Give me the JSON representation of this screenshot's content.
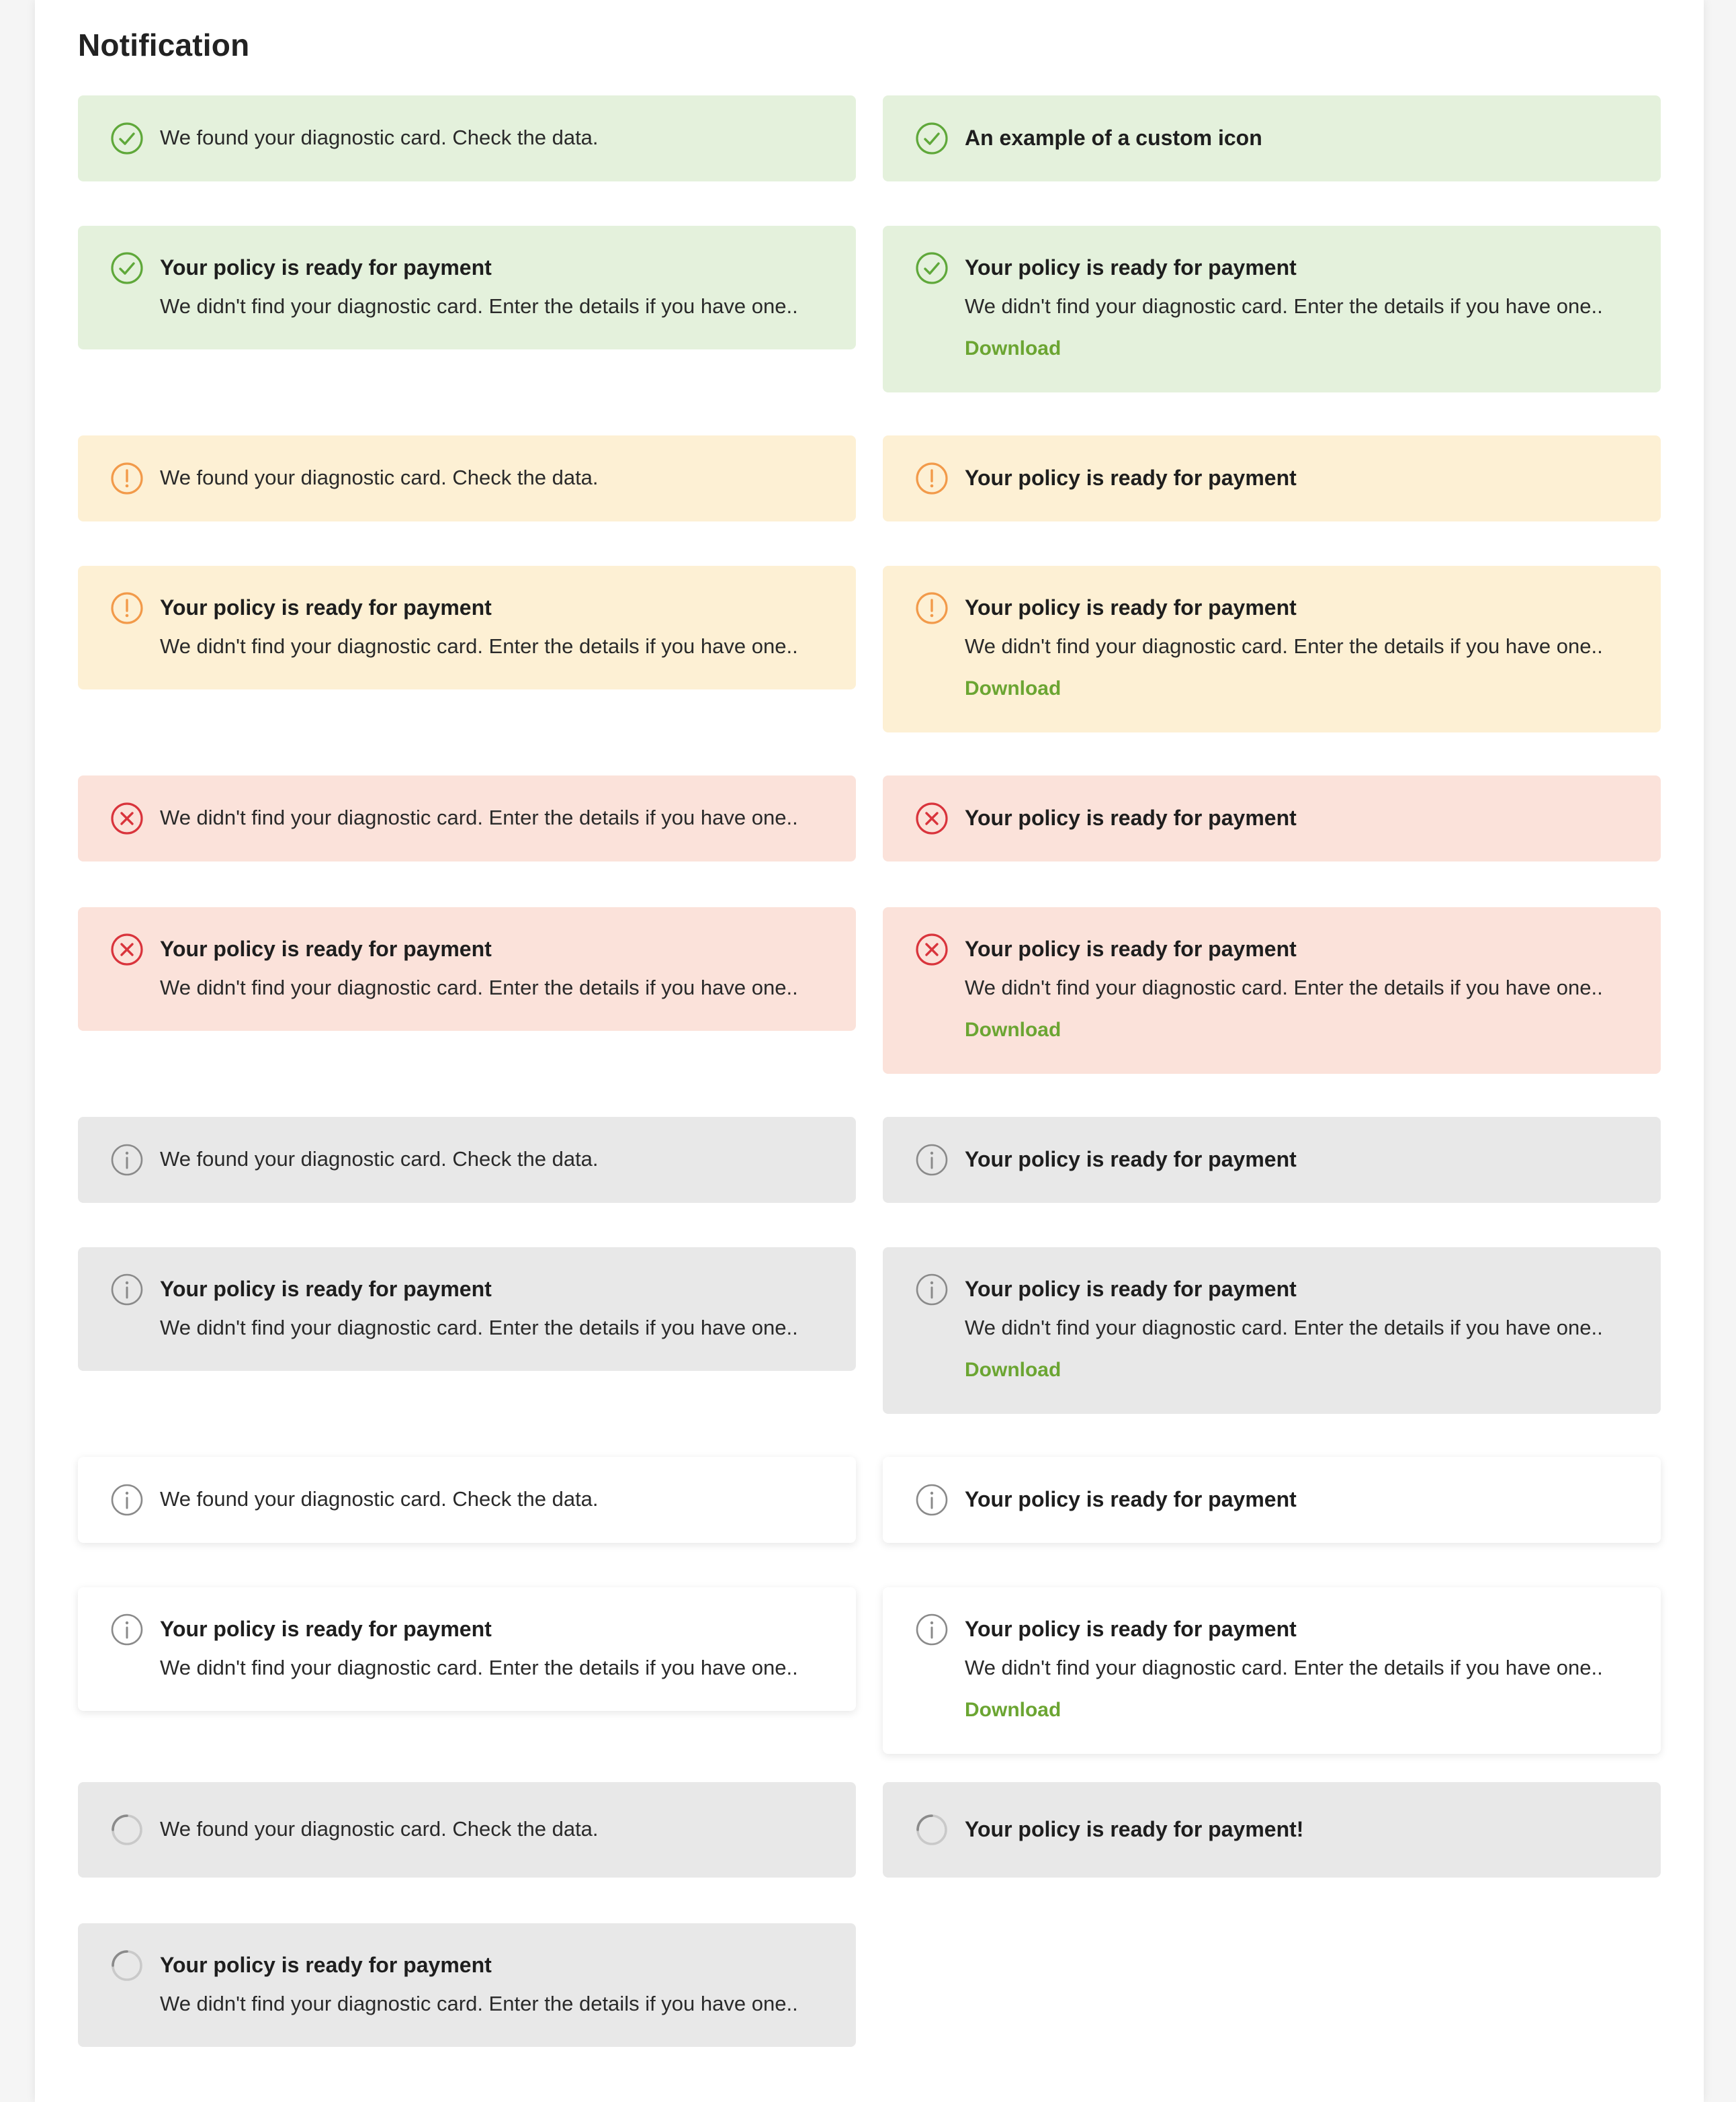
{
  "page": {
    "title": "Notification"
  },
  "colors": {
    "success_bg": "#e4f1dc",
    "success_icon": "#5fa83a",
    "warning_bg": "#fdf0d4",
    "warning_icon": "#f29a4a",
    "error_bg": "#fbe2da",
    "error_icon": "#d9343c",
    "info_bg": "#e8e8e8",
    "info_icon": "#8a8a8a",
    "link": "#6ba532"
  },
  "notifications": [
    {
      "variant": "success",
      "icon": "check-circle-icon",
      "text": "We found your diagnostic card. Check the data."
    },
    {
      "variant": "success",
      "icon": "check-circle-icon",
      "heading": "An example of a custom icon"
    },
    {
      "variant": "success",
      "icon": "check-circle-icon",
      "heading": "Your policy is ready for payment",
      "body": "We didn't find your diagnostic card. Enter the details if you have one.."
    },
    {
      "variant": "success",
      "icon": "check-circle-icon",
      "heading": "Your policy is ready for payment",
      "body": "We didn't find your diagnostic card. Enter the details if you have one..",
      "link": "Download"
    },
    {
      "variant": "warning",
      "icon": "exclamation-circle-icon",
      "text": "We found your diagnostic card. Check the data."
    },
    {
      "variant": "warning",
      "icon": "exclamation-circle-icon",
      "heading": "Your policy is ready for payment"
    },
    {
      "variant": "warning",
      "icon": "exclamation-circle-icon",
      "heading": "Your policy is ready for payment",
      "body": "We didn't find your diagnostic card. Enter the details if you have one.."
    },
    {
      "variant": "warning",
      "icon": "exclamation-circle-icon",
      "heading": "Your policy is ready for payment",
      "body": "We didn't find your diagnostic card. Enter the details if you have one..",
      "link": "Download"
    },
    {
      "variant": "error",
      "icon": "x-circle-icon",
      "text": "We didn't find your diagnostic card. Enter the details if you have one.."
    },
    {
      "variant": "error",
      "icon": "x-circle-icon",
      "heading": "Your policy is ready for payment"
    },
    {
      "variant": "error",
      "icon": "x-circle-icon",
      "heading": "Your policy is ready for payment",
      "body": "We didn't find your diagnostic card. Enter the details if you have one.."
    },
    {
      "variant": "error",
      "icon": "x-circle-icon",
      "heading": "Your policy is ready for payment",
      "body": "We didn't find your diagnostic card. Enter the details if you have one..",
      "link": "Download"
    },
    {
      "variant": "info",
      "icon": "info-circle-icon",
      "text": "We found your diagnostic card. Check the data."
    },
    {
      "variant": "info",
      "icon": "info-circle-icon",
      "heading": "Your policy is ready for payment"
    },
    {
      "variant": "info",
      "icon": "info-circle-icon",
      "heading": "Your policy is ready for payment",
      "body": "We didn't find your diagnostic card. Enter the details if you have one.."
    },
    {
      "variant": "info",
      "icon": "info-circle-icon",
      "heading": "Your policy is ready for payment",
      "body": "We didn't find your diagnostic card. Enter the details if you have one..",
      "link": "Download"
    },
    {
      "variant": "plain",
      "icon": "info-circle-icon",
      "text": "We found your diagnostic card. Check the data."
    },
    {
      "variant": "plain",
      "icon": "info-circle-icon",
      "heading": "Your policy is ready for payment"
    },
    {
      "variant": "plain",
      "icon": "info-circle-icon",
      "heading": "Your policy is ready for payment",
      "body": "We didn't find your diagnostic card. Enter the details if you have one.."
    },
    {
      "variant": "plain",
      "icon": "info-circle-icon",
      "heading": "Your policy is ready for payment",
      "body": "We didn't find your diagnostic card. Enter the details if you have one..",
      "link": "Download"
    },
    {
      "variant": "loading",
      "icon": "spinner-icon",
      "text": "We found your diagnostic card. Check the data."
    },
    {
      "variant": "loading",
      "icon": "spinner-icon",
      "heading": "Your policy is ready for payment!"
    },
    {
      "variant": "loading",
      "icon": "spinner-icon",
      "heading": "Your policy is ready for payment",
      "body": "We didn't find your diagnostic card. Enter the details if you have one.."
    }
  ]
}
